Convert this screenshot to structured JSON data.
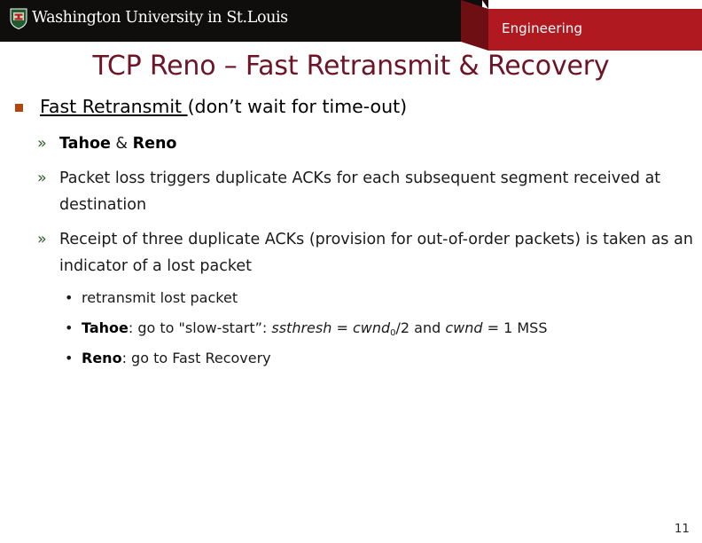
{
  "header": {
    "university_name": "Washington University in St.Louis",
    "crest_icon": "shield-crest-icon",
    "school_label": "Engineering",
    "colors": {
      "black_bar": "#100d0d",
      "red_banner": "#b01920",
      "bevel_dark_red": "#6d0f13"
    }
  },
  "slide": {
    "title": "TCP Reno – Fast Retransmit & Recovery",
    "title_color": "#6e1427",
    "page_number": "11"
  },
  "content": {
    "level1": {
      "bullet_icon": "square-bullet",
      "bullet_color": "#b3460f",
      "underlined_text": "Fast Retransmit ",
      "rest_text": "(don’t wait for time-out)"
    },
    "level2": [
      {
        "marker": "»",
        "marker_color": "#2f5d2f",
        "bold_part": "Tahoe",
        "plain_part": " & ",
        "bold_part2": "Reno"
      },
      {
        "marker": "»",
        "marker_color": "#2f5d2f",
        "text": "Packet loss triggers duplicate ACKs for each subsequent segment received at destination"
      },
      {
        "marker": "»",
        "marker_color": "#2f5d2f",
        "text": "Receipt of three duplicate ACKs (provision for out-of-order packets) is taken as an indicator of a lost packet"
      }
    ],
    "level3": [
      {
        "marker": "•",
        "text": "retransmit lost packet"
      },
      {
        "marker": "•",
        "bold_label": "Tahoe",
        "seg1": ": go to \"slow-start”: ",
        "ital1": "ssthresh",
        "seg2": " = ",
        "ital2": "cwnd",
        "sub": "0",
        "seg3": "/2 and ",
        "ital3": "cwnd",
        "seg4": " = 1 MSS"
      },
      {
        "marker": "•",
        "bold_label": "Reno",
        "seg1": ": go to Fast Recovery"
      }
    ]
  }
}
